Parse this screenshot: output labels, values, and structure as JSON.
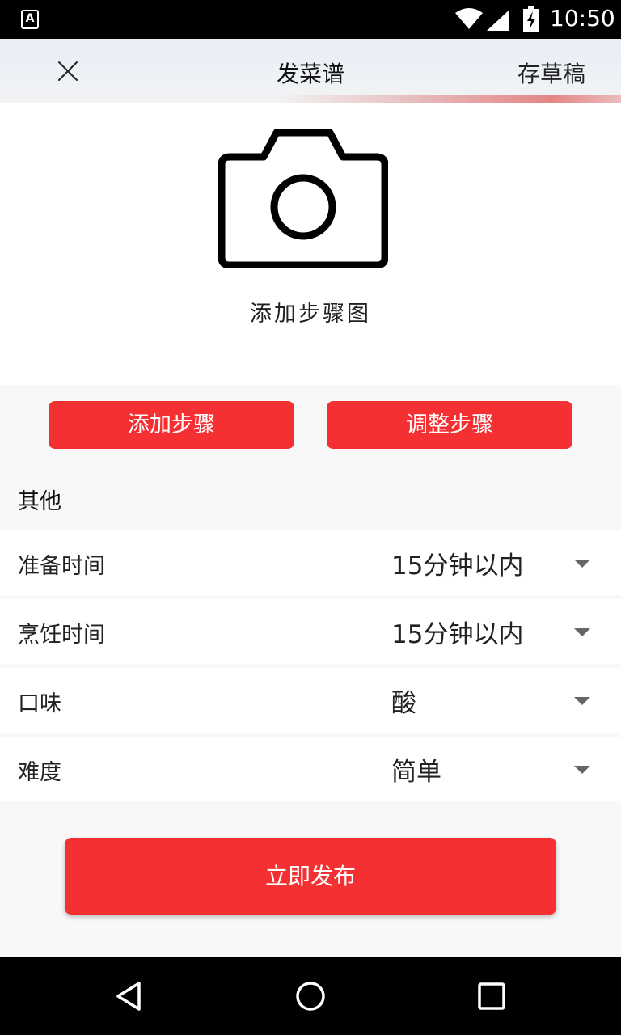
{
  "status_bar": {
    "time": "10:50",
    "notification_icon_letter": "A",
    "icons": [
      "wifi-icon",
      "signal-icon",
      "battery-charging-icon"
    ]
  },
  "header": {
    "title": "发菜谱",
    "draft_label": "存草稿",
    "close_icon": "close-icon"
  },
  "upload": {
    "label": "添加步骤图",
    "icon": "camera-icon"
  },
  "steps": {
    "add_label": "添加步骤",
    "adjust_label": "调整步骤"
  },
  "other_section": {
    "title": "其他",
    "options": [
      {
        "label": "准备时间",
        "value": "15分钟以内"
      },
      {
        "label": "烹饪时间",
        "value": "15分钟以内"
      },
      {
        "label": "口味",
        "value": "酸"
      },
      {
        "label": "难度",
        "value": "简单"
      }
    ]
  },
  "publish": {
    "label": "立即发布"
  },
  "colors": {
    "accent": "#f53033",
    "background": "#f8f8f8"
  }
}
